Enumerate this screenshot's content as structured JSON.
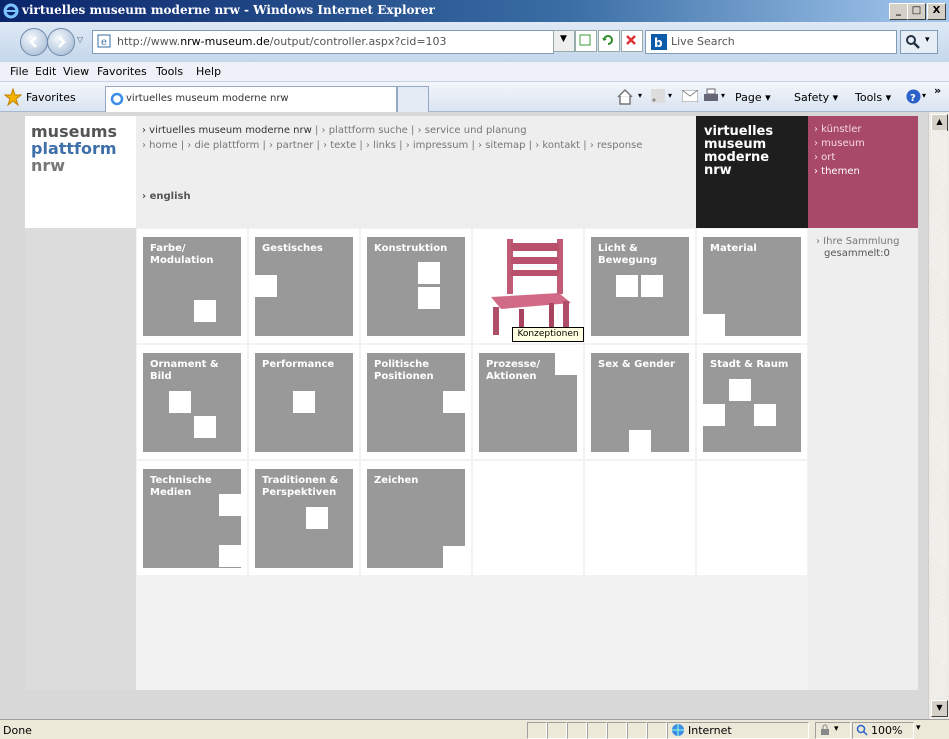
{
  "window": {
    "title": "virtuelles museum moderne nrw - Windows Internet Explorer",
    "minimize": "_",
    "maximize": "□",
    "close": "X"
  },
  "address": {
    "url_prefix": "http://www.",
    "url_domain": "nrw-museum.de",
    "url_path": "/output/controller.aspx?cid=103"
  },
  "search": {
    "placeholder": "Live Search"
  },
  "menu": [
    "File",
    "Edit",
    "View",
    "Favorites",
    "Tools",
    "Help"
  ],
  "favorites_bar": {
    "favorites": "Favorites",
    "tab_title": "virtuelles museum moderne nrw",
    "page": "Page ▾",
    "safety": "Safety ▾",
    "tools": "Tools ▾",
    "chevron": "»"
  },
  "site": {
    "logo": {
      "line1": "museums",
      "line2": "plattform",
      "line3": "nrw"
    },
    "nav1": [
      {
        "label": "› virtuelles museum moderne nrw",
        "active": true
      },
      {
        "label": "› plattform suche",
        "active": false
      },
      {
        "label": "› service und planung",
        "active": false
      }
    ],
    "nav2": [
      "› home",
      "› die plattform",
      "› partner",
      "› texte",
      "› links",
      "› impressum",
      "› sitemap",
      "› kontakt",
      "› response"
    ],
    "english": "› english",
    "brand": {
      "l1": "virtuelles",
      "l2": "museum",
      "l3": "moderne",
      "l4": "nrw"
    },
    "sidenav": [
      "› künstler",
      "› museum",
      "› ort",
      "› themen"
    ],
    "collection": {
      "label": "› Ihre Sammlung",
      "value": "gesammelt:0"
    },
    "tooltip": "Konzeptionen",
    "tiles": [
      {
        "l1": "Farbe/",
        "l2": "Modulation"
      },
      {
        "l1": "Gestisches",
        "l2": ""
      },
      {
        "l1": "Konstruktion",
        "l2": ""
      },
      {
        "l1": "",
        "l2": ""
      },
      {
        "l1": "Licht &",
        "l2": "Bewegung"
      },
      {
        "l1": "Material",
        "l2": ""
      },
      {
        "l1": "Ornament &",
        "l2": "Bild"
      },
      {
        "l1": "Performance",
        "l2": ""
      },
      {
        "l1": "Politische",
        "l2": "Positionen"
      },
      {
        "l1": "Prozesse/",
        "l2": "Aktionen"
      },
      {
        "l1": "Sex & Gender",
        "l2": ""
      },
      {
        "l1": "Stadt & Raum",
        "l2": ""
      },
      {
        "l1": "Technische",
        "l2": "Medien"
      },
      {
        "l1": "Traditionen &",
        "l2": "Perspektiven"
      },
      {
        "l1": "Zeichen",
        "l2": ""
      }
    ]
  },
  "status": {
    "text": "Done",
    "zone": "Internet",
    "zoom": "100%"
  }
}
